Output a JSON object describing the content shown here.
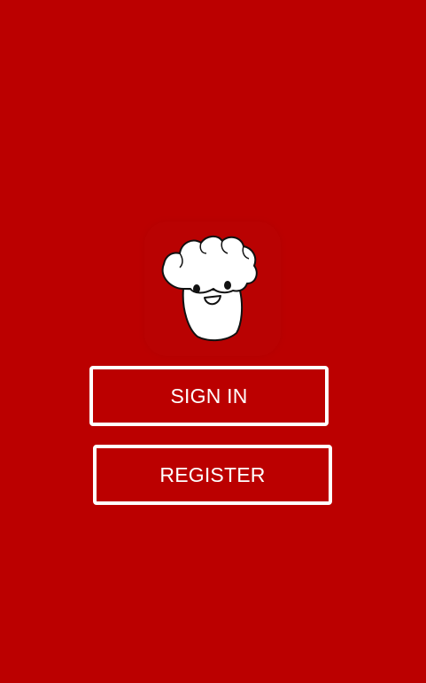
{
  "app": {
    "background_color": "#bb0000",
    "logo_icon": "popcorn-mascot-icon"
  },
  "auth": {
    "sign_in_label": "SIGN IN",
    "register_label": "REGISTER"
  }
}
